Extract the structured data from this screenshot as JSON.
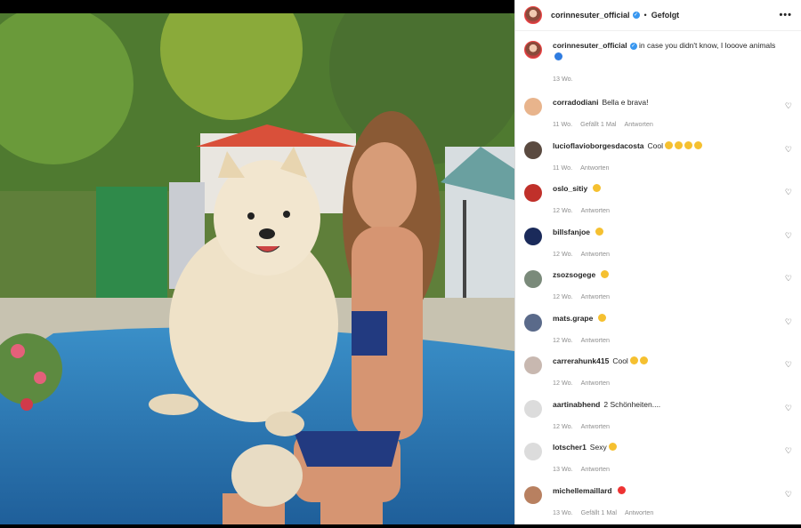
{
  "post": {
    "author": "corinnesuter_official",
    "following_label": "Gefolgt",
    "more_label": "•••"
  },
  "caption": {
    "username": "corinnesuter_official",
    "text": "in case you didn't know, I looove animals",
    "emoji": "blue-heart-emoji",
    "time": "13 Wo."
  },
  "comments": [
    {
      "username": "corradodiani",
      "text": "Bella e brava!",
      "emoji": [],
      "time": "11 Wo.",
      "likes": "Gefällt 1 Mal",
      "reply": "Antworten",
      "avatar_color": "#e8b48c"
    },
    {
      "username": "lucioflavioborgesdacosta",
      "text": "Cool",
      "emoji": [
        "sunglasses-emoji",
        "clap-emoji",
        "clap-emoji",
        "clap-emoji"
      ],
      "time": "11 Wo.",
      "likes": "",
      "reply": "Antworten",
      "avatar_color": "#5a4a40"
    },
    {
      "username": "oslo_sitiy",
      "text": "",
      "emoji": [
        "star-struck-emoji"
      ],
      "time": "12 Wo.",
      "likes": "",
      "reply": "Antworten",
      "avatar_color": "#c0302a"
    },
    {
      "username": "billsfanjoe",
      "text": "",
      "emoji": [
        "raised-hand-emoji"
      ],
      "time": "12 Wo.",
      "likes": "",
      "reply": "Antworten",
      "avatar_color": "#1a2a5a"
    },
    {
      "username": "zsozsogege",
      "text": "",
      "emoji": [
        "clap-emoji"
      ],
      "time": "12 Wo.",
      "likes": "",
      "reply": "Antworten",
      "avatar_color": "#7a8a7a"
    },
    {
      "username": "mats.grape",
      "text": "",
      "emoji": [
        "grinning-emoji"
      ],
      "time": "12 Wo.",
      "likes": "",
      "reply": "Antworten",
      "avatar_color": "#5a6a8a"
    },
    {
      "username": "carrerahunk415",
      "text": "Cool",
      "emoji": [
        "grinning-emoji",
        "grinning-emoji"
      ],
      "time": "12 Wo.",
      "likes": "",
      "reply": "Antworten",
      "avatar_color": "#c8b8b0"
    },
    {
      "username": "aartinabhend",
      "text": "2 Schönheiten....",
      "emoji": [],
      "time": "12 Wo.",
      "likes": "",
      "reply": "Antworten",
      "avatar_color": "#dcdcdc"
    },
    {
      "username": "lotscher1",
      "text": "Sexy",
      "emoji": [
        "fire-emoji"
      ],
      "time": "13 Wo.",
      "likes": "",
      "reply": "Antworten",
      "avatar_color": "#dcdcdc"
    },
    {
      "username": "michellemaillard",
      "text": "",
      "emoji": [
        "red-heart-emoji"
      ],
      "time": "13 Wo.",
      "likes": "Gefällt 1 Mal",
      "reply": "Antworten",
      "avatar_color": "#b88060"
    }
  ]
}
